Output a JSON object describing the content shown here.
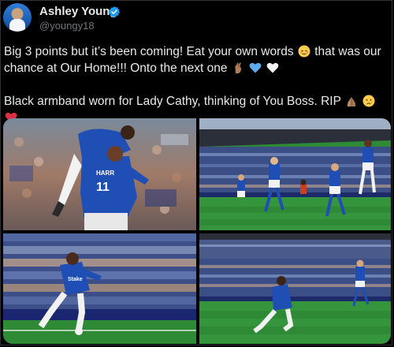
{
  "author": {
    "name": "Ashley Young",
    "handle": "@youngy18",
    "verified_icon": "verified-badge-icon"
  },
  "tweet": {
    "line1": "Big 3 points but it’s been coming! Eat your own words",
    "line1b": "that was our",
    "line2": "chance at Our Home!!! Onto the next one",
    "line3": "Black armband worn for Lady Cathy, thinking of You Boss. RIP",
    "emoji_after_words": "relieved-face-emoji",
    "emoji_after_line2": [
      "crossed-fingers-emoji",
      "blue-heart-emoji",
      "white-heart-emoji"
    ],
    "emoji_after_rip": [
      "folded-hands-emoji",
      "crying-face-emoji",
      "red-heart-emoji"
    ]
  },
  "media": {
    "tiles": [
      {
        "subject": "players celebrating hug photo",
        "shirt_text": "HARR",
        "number": "11"
      },
      {
        "subject": "players running on pitch photo"
      },
      {
        "subject": "player sliding celebration photo",
        "shirt_text": "Stake"
      },
      {
        "subject": "player knee slide photo"
      }
    ]
  },
  "colors": {
    "background": "#000000",
    "text": "#e7e9ea",
    "secondary_text": "#71767b",
    "verified_blue": "#1d9bf0",
    "everton_blue": "#1f4fb4",
    "pitch_green": "#2f8a36"
  }
}
